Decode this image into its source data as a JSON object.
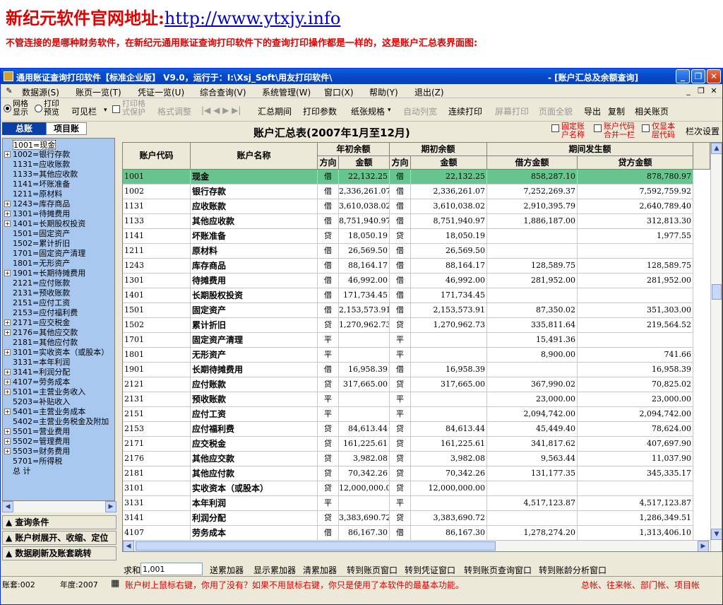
{
  "banner": {
    "title": "新纪元软件官网地址:",
    "url": "http://www.ytxjy.info",
    "desc": "不管连接的是哪种财务软件，在新纪元通用账证查询打印软件下的查询打印操作都是一样的，这是账户汇总表界面图:"
  },
  "window": {
    "title": "通用账证查询打印软件【标准企业版】 V9.0，运行于：I:\\Xsj_Soft\\用友打印软件\\",
    "doc_title": "- [账户汇总及余额查询]"
  },
  "menu": [
    "数据源(S)",
    "账页一览(T)",
    "凭证一览(U)",
    "综合查询(V)",
    "系统管理(W)",
    "窗口(X)",
    "帮助(Y)",
    "退出(Z)"
  ],
  "toolbar": {
    "grid_show": [
      "网格",
      "显示"
    ],
    "print_preview": [
      "打印",
      "预览"
    ],
    "visible_cols": "可见栏",
    "print_grid_protect": [
      "打印格",
      "式保护"
    ],
    "format_adjust": "格式调整",
    "nav": "|◀ ◀ ▶ ▶|",
    "buttons": [
      "汇总期间",
      "打印参数",
      "纸张规格",
      "自动列宽",
      "连续打印",
      "屏幕打印",
      "页面全貌",
      "导出",
      "复制",
      "相关账页"
    ]
  },
  "left": {
    "tab_total": "总账",
    "tab_project": "项目账",
    "tree": [
      {
        "code": "1001=现金",
        "exp": false
      },
      {
        "code": "1002=银行存款",
        "exp": true
      },
      {
        "code": "1131=应收账款",
        "exp": false
      },
      {
        "code": "1133=其他应收款",
        "exp": false
      },
      {
        "code": "1141=坏账准备",
        "exp": false
      },
      {
        "code": "1211=原材料",
        "exp": false
      },
      {
        "code": "1243=库存商品",
        "exp": true
      },
      {
        "code": "1301=待摊费用",
        "exp": true
      },
      {
        "code": "1401=长期股权投资",
        "exp": true
      },
      {
        "code": "1501=固定资产",
        "exp": false
      },
      {
        "code": "1502=累计折旧",
        "exp": false
      },
      {
        "code": "1701=固定资产清理",
        "exp": false
      },
      {
        "code": "1801=无形资产",
        "exp": false
      },
      {
        "code": "1901=长期待摊费用",
        "exp": true
      },
      {
        "code": "2121=应付账款",
        "exp": false
      },
      {
        "code": "2131=预收账款",
        "exp": false
      },
      {
        "code": "2151=应付工资",
        "exp": false
      },
      {
        "code": "2153=应付福利费",
        "exp": false
      },
      {
        "code": "2171=应交税金",
        "exp": true
      },
      {
        "code": "2176=其他应交款",
        "exp": true
      },
      {
        "code": "2181=其他应付款",
        "exp": false
      },
      {
        "code": "3101=实收资本（或股本）",
        "exp": true
      },
      {
        "code": "3131=本年利润",
        "exp": false
      },
      {
        "code": "3141=利润分配",
        "exp": true
      },
      {
        "code": "4107=劳务成本",
        "exp": true
      },
      {
        "code": "5101=主营业务收入",
        "exp": true
      },
      {
        "code": "5203=补贴收入",
        "exp": false
      },
      {
        "code": "5401=主营业务成本",
        "exp": true
      },
      {
        "code": "5402=主营业务税金及附加",
        "exp": false
      },
      {
        "code": "5501=营业费用",
        "exp": true
      },
      {
        "code": "5502=管理费用",
        "exp": true
      },
      {
        "code": "5503=财务费用",
        "exp": true
      },
      {
        "code": "5701=所得税",
        "exp": false
      },
      {
        "code": "总  计",
        "exp": false
      }
    ],
    "buttons": [
      "▲ 查询条件",
      "▲ 账户树展开、收缩、定位",
      "▲ 数据刷新及账套跳转"
    ]
  },
  "report": {
    "title": "账户汇总表(2007年1月至12月)",
    "opt1": [
      "固定账",
      "户名称"
    ],
    "opt2": [
      "账户代码",
      "合并一栏"
    ],
    "opt3": [
      "仅显本",
      "层代码"
    ],
    "col_settings": "栏次设置",
    "headers": {
      "code": "账户代码",
      "name": "账户名称",
      "year_open": "年初余额",
      "period_open": "期初余额",
      "period_amt": "期间发生额",
      "dir": "方向",
      "amount": "金额",
      "debit": "借方金额",
      "credit": "贷方金额"
    },
    "rows": [
      [
        "1001",
        "现金",
        "借",
        "22,132.25",
        "借",
        "22,132.25",
        "858,287.10",
        "878,780.97"
      ],
      [
        "1002",
        "银行存款",
        "借",
        "2,336,261.07",
        "借",
        "2,336,261.07",
        "7,252,269.37",
        "7,592,759.92"
      ],
      [
        "1131",
        "应收账款",
        "借",
        "3,610,038.02",
        "借",
        "3,610,038.02",
        "2,910,395.79",
        "2,640,789.40"
      ],
      [
        "1133",
        "其他应收款",
        "借",
        "8,751,940.97",
        "借",
        "8,751,940.97",
        "1,886,187.00",
        "312,813.30"
      ],
      [
        "1141",
        "坏账准备",
        "贷",
        "18,050.19",
        "贷",
        "18,050.19",
        "",
        "1,977.55"
      ],
      [
        "1211",
        "原材料",
        "借",
        "26,569.50",
        "借",
        "26,569.50",
        "",
        ""
      ],
      [
        "1243",
        "库存商品",
        "借",
        "88,164.17",
        "借",
        "88,164.17",
        "128,589.75",
        "128,589.75"
      ],
      [
        "1301",
        "待摊费用",
        "借",
        "46,992.00",
        "借",
        "46,992.00",
        "281,952.00",
        "281,952.00"
      ],
      [
        "1401",
        "长期股权投资",
        "借",
        "171,734.45",
        "借",
        "171,734.45",
        "",
        ""
      ],
      [
        "1501",
        "固定资产",
        "借",
        "2,153,573.91",
        "借",
        "2,153,573.91",
        "87,350.02",
        "351,303.00"
      ],
      [
        "1502",
        "累计折旧",
        "贷",
        "1,270,962.73",
        "贷",
        "1,270,962.73",
        "335,811.64",
        "219,564.52"
      ],
      [
        "1701",
        "固定资产清理",
        "平",
        "",
        "平",
        "",
        "15,491.36",
        ""
      ],
      [
        "1801",
        "无形资产",
        "平",
        "",
        "平",
        "",
        "8,900.00",
        "741.66"
      ],
      [
        "1901",
        "长期待摊费用",
        "借",
        "16,958.39",
        "借",
        "16,958.39",
        "",
        "16,958.39"
      ],
      [
        "2121",
        "应付账款",
        "贷",
        "317,665.00",
        "贷",
        "317,665.00",
        "367,990.02",
        "70,825.02"
      ],
      [
        "2131",
        "预收账款",
        "平",
        "",
        "平",
        "",
        "23,000.00",
        "23,000.00"
      ],
      [
        "2151",
        "应付工资",
        "平",
        "",
        "平",
        "",
        "2,094,742.00",
        "2,094,742.00"
      ],
      [
        "2153",
        "应付福利费",
        "贷",
        "84,613.44",
        "贷",
        "84,613.44",
        "45,449.40",
        "78,624.00"
      ],
      [
        "2171",
        "应交税金",
        "贷",
        "161,225.61",
        "贷",
        "161,225.61",
        "341,817.62",
        "407,697.90"
      ],
      [
        "2176",
        "其他应交款",
        "贷",
        "3,982.08",
        "贷",
        "3,982.08",
        "9,563.44",
        "11,037.90"
      ],
      [
        "2181",
        "其他应付款",
        "贷",
        "70,342.26",
        "贷",
        "70,342.26",
        "131,177.35",
        "345,335.17"
      ],
      [
        "3101",
        "实收资本（或股本）",
        "贷",
        "12,000,000.00",
        "贷",
        "12,000,000.00",
        "",
        ""
      ],
      [
        "3131",
        "本年利润",
        "平",
        "",
        "平",
        "",
        "4,517,123.87",
        "4,517,123.87"
      ],
      [
        "3141",
        "利润分配",
        "贷",
        "3,383,690.72",
        "贷",
        "3,383,690.72",
        "",
        "1,286,349.51"
      ],
      [
        "4107",
        "劳务成本",
        "借",
        "86,167.30",
        "借",
        "86,167.30",
        "1,278,274.20",
        "1,313,406.10"
      ]
    ]
  },
  "bottom": {
    "sum_label": "求和",
    "sum_value": "1,001",
    "buttons": [
      "送累加器",
      "显示累加器",
      "清累加器",
      "转到账页窗口",
      "转到凭证窗口",
      "转到账页查询窗口",
      "转到账龄分析窗口"
    ]
  },
  "status": {
    "set": "账套:002",
    "year": "年度:2007",
    "hint": "账户树上鼠标右键，你用了没有？如果不用鼠标右键，你只是使用了本软件的最基本功能。",
    "hint2": "总帐、往来帐、部门帐、项目帐"
  }
}
